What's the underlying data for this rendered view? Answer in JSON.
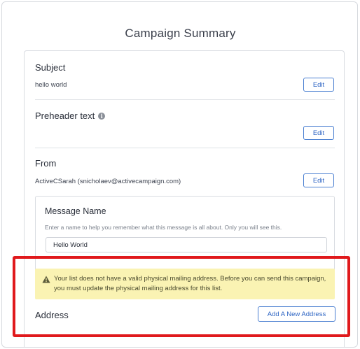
{
  "modal": {
    "title": "Campaign Summary"
  },
  "subject": {
    "label": "Subject",
    "value": "hello world",
    "edit_label": "Edit"
  },
  "preheader": {
    "label": "Preheader text",
    "info_icon": "i",
    "edit_label": "Edit"
  },
  "from": {
    "label": "From",
    "value": "ActiveCSarah (snicholaev@activecampaign.com)",
    "edit_label": "Edit"
  },
  "message_name": {
    "label": "Message Name",
    "help": "Enter a name to help you remember what this message is all about. Only you will see this.",
    "value": "Hello World"
  },
  "warning": {
    "icon": "warning-triangle-icon",
    "text": "Your list does not have a valid physical mailing address. Before you can send this campaign, you must update the physical mailing address for this list."
  },
  "address": {
    "label": "Address",
    "add_label": "Add A New Address"
  },
  "colors": {
    "accent": "#2f66c4",
    "warning_bg": "#faf3b3",
    "highlight": "#e0191c"
  }
}
